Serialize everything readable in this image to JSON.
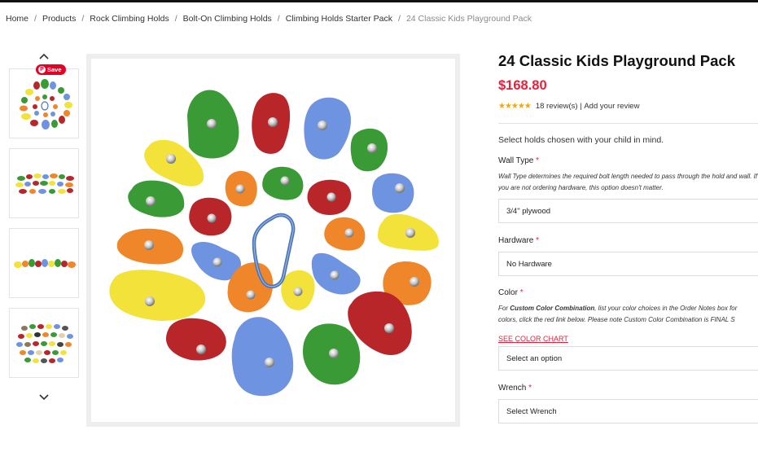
{
  "breadcrumb": {
    "items": [
      "Home",
      "Products",
      "Rock Climbing Holds",
      "Bolt-On Climbing Holds",
      "Climbing Holds Starter Pack"
    ],
    "current": "24 Classic Kids Playground Pack"
  },
  "gallery": {
    "save_label": "Save",
    "pin_glyph": "P"
  },
  "product": {
    "title": "24 Classic Kids Playground Pack",
    "price": "$168.80",
    "stars": "★★★★★",
    "rating": 5,
    "reviews": "18 review(s)",
    "separator": " | ",
    "add_review": "Add your review",
    "intro": "Select holds chosen with your child in mind."
  },
  "form": {
    "wall_type": {
      "label": "Wall Type",
      "required_mark": "*",
      "help": "Wall Type determines the required bolt length needed to pass through the hold and wall. If you are not ordering hardware, this option doesn't matter.",
      "value": "3/4\" plywood"
    },
    "hardware": {
      "label": "Hardware",
      "required_mark": "*",
      "value": "No Hardware"
    },
    "color": {
      "label": "Color",
      "required_mark": "*",
      "help_prefix": "For ",
      "help_bold": "Custom Color Combination",
      "help_rest": ", list your color choices in the Order Notes box for",
      "help_line2": "colors, click the red link below. Please note Custom Color Combination is FINAL S",
      "chart_link": "SEE COLOR CHART",
      "value": "Select an option"
    },
    "wrench": {
      "label": "Wrench",
      "required_mark": "*",
      "value": "Select Wrench"
    }
  },
  "colors": {
    "price": "#e8203a",
    "required": "#e8203a",
    "stars": "#f2a900",
    "save_button": "#e60023",
    "hold_green": "#3a9a35",
    "hold_red": "#b8262a",
    "hold_blue": "#6e93e0",
    "hold_yellow": "#f2e23a",
    "hold_orange": "#f0862a",
    "carabiner": "#4a76b8"
  }
}
